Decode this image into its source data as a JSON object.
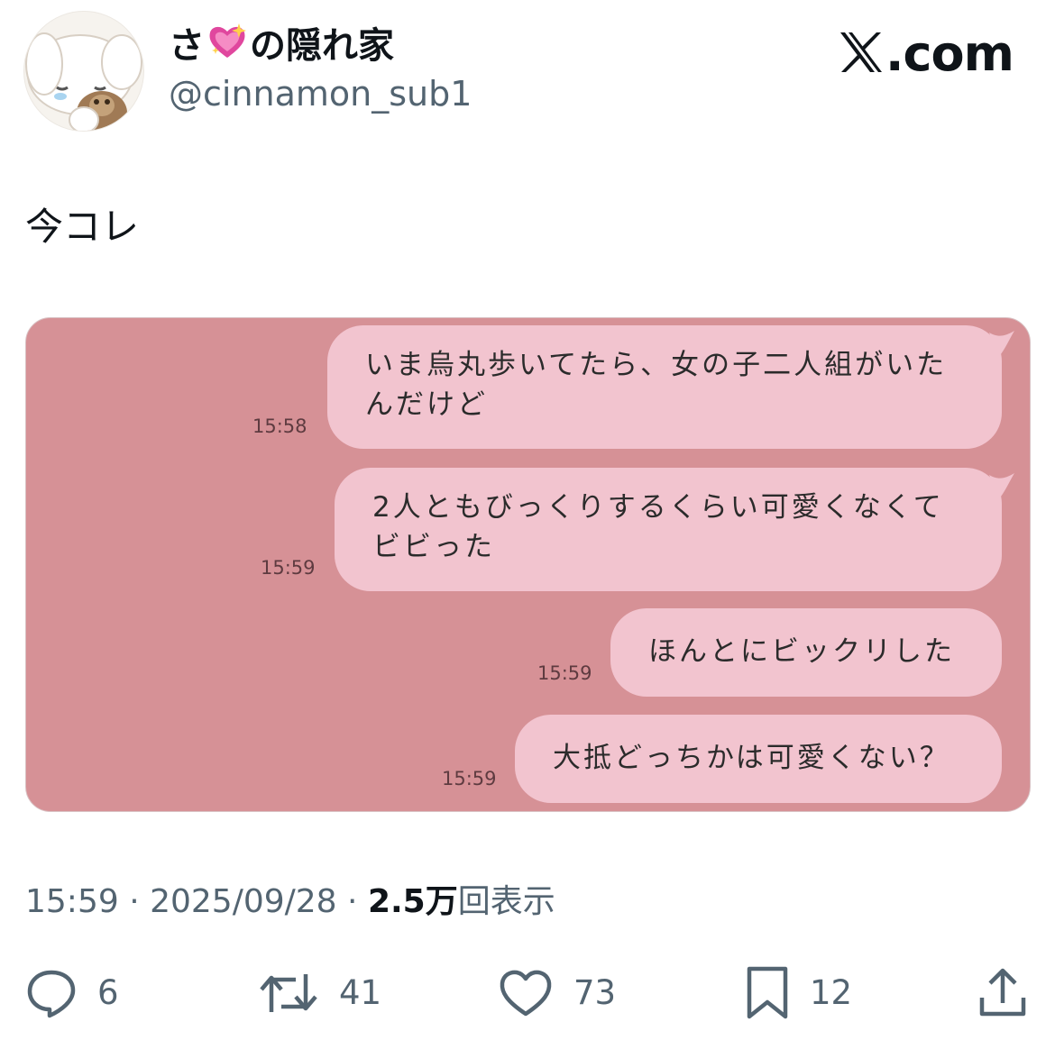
{
  "header": {
    "name_start": "さ",
    "name_end": "の隠れ家",
    "name_emoji": "sparkling-heart-icon",
    "handle": "@cinnamon_sub1",
    "site_logo": ".com"
  },
  "tweet": {
    "text": "今コレ"
  },
  "chat": {
    "messages": [
      {
        "lines": [
          "いま烏丸歩いてたら、女の子二人組がいた",
          "んだけど"
        ],
        "time": "15:58"
      },
      {
        "lines": [
          "2人ともびっくりするくらい可愛くなくて",
          "ビビった"
        ],
        "time": "15:59"
      },
      {
        "lines": [
          "ほんとにビックリした"
        ],
        "time": "15:59"
      },
      {
        "lines": [
          "大抵どっちかは可愛くない？"
        ],
        "time": "15:59"
      }
    ],
    "background_color": "#d69196",
    "bubble_color": "#f2c4cf"
  },
  "meta": {
    "time": "15:59",
    "sep1": " · ",
    "date": "2025/09/28",
    "sep2": " · ",
    "views_count": "2.5万",
    "views_label": "回表示"
  },
  "actions": {
    "replies": "6",
    "reposts": "41",
    "likes": "73",
    "bookmarks": "12"
  }
}
